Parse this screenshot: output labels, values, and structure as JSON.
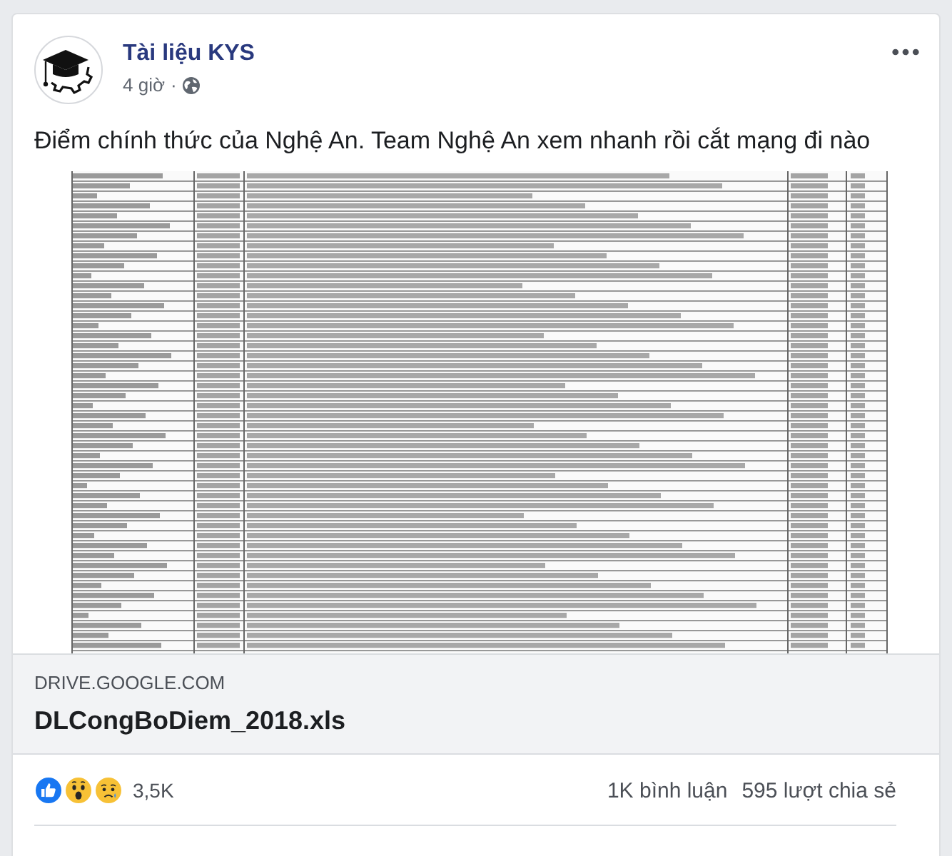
{
  "post": {
    "author": "Tài liệu KYS",
    "time": "4 giờ",
    "separator": "·",
    "text": "Điểm chính thức của Nghệ An. Team Nghệ An xem nhanh rồi cắt mạng đi nào"
  },
  "link": {
    "domain": "DRIVE.GOOGLE.COM",
    "title": "DLCongBoDiem_2018.xls"
  },
  "stats": {
    "reactions": [
      {
        "kind": "like"
      },
      {
        "kind": "wow"
      },
      {
        "kind": "sad"
      }
    ],
    "reaction_count": "3,5K",
    "comments": "1K bình luận",
    "shares": "595 lượt chia sẻ"
  }
}
